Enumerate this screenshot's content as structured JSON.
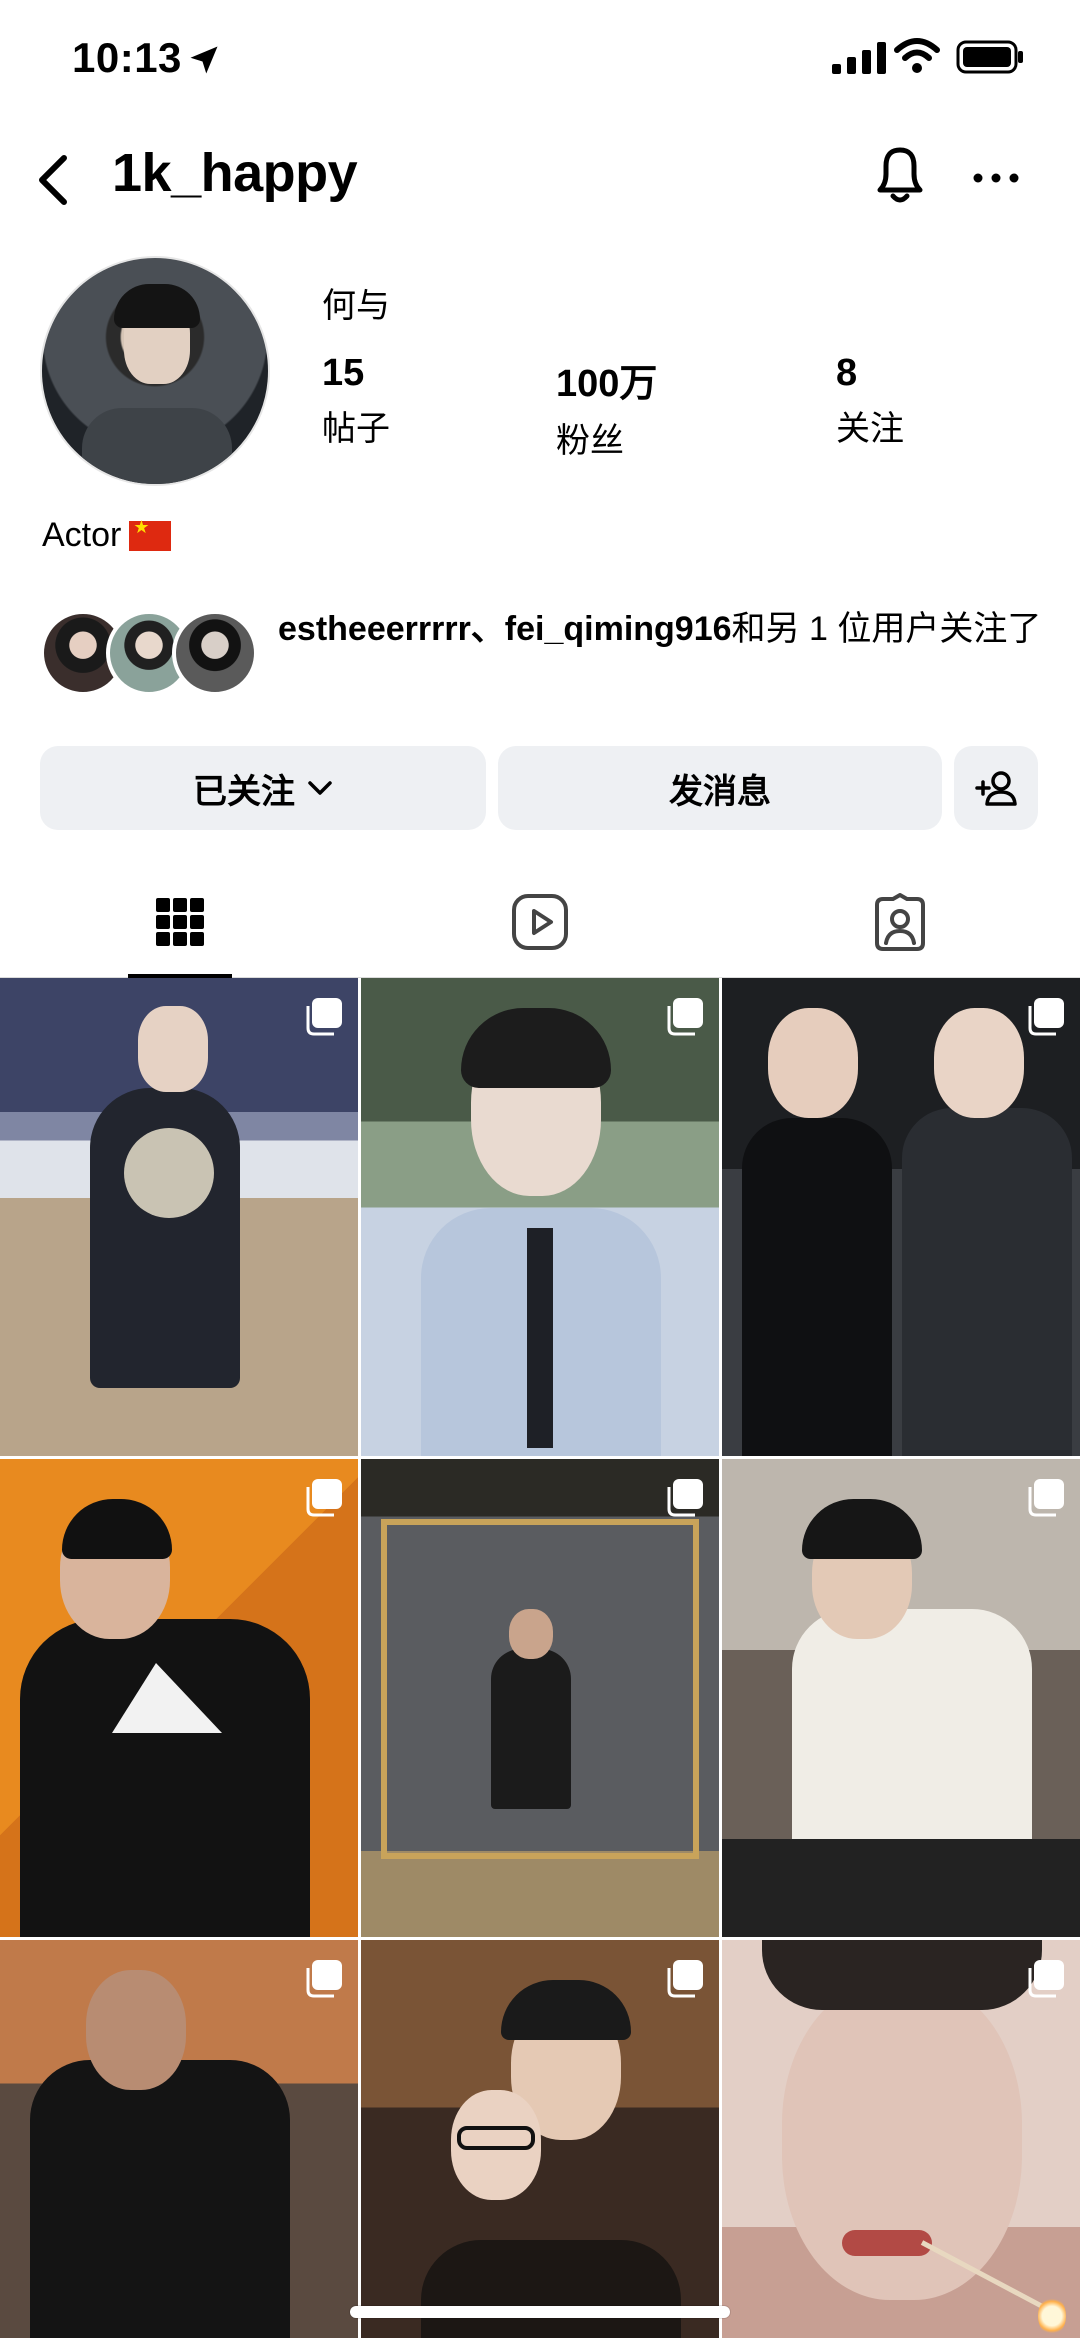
{
  "status_bar": {
    "time": "10:13"
  },
  "header": {
    "username": "1k_happy"
  },
  "profile": {
    "display_name": "何与",
    "stats": [
      {
        "value": "15",
        "label": "帖子"
      },
      {
        "value": "100万",
        "label": "粉丝"
      },
      {
        "value": "8",
        "label": "关注"
      }
    ],
    "bio": "Actor"
  },
  "mutual": {
    "names": "estheeerrrrr、fei_qiming916",
    "suffix": "和另 1 位用户关注了"
  },
  "buttons": {
    "following": "已关注",
    "message": "发消息"
  },
  "tabs": [
    "posts-grid",
    "reels",
    "tagged"
  ],
  "grid": {
    "cells": 9
  }
}
